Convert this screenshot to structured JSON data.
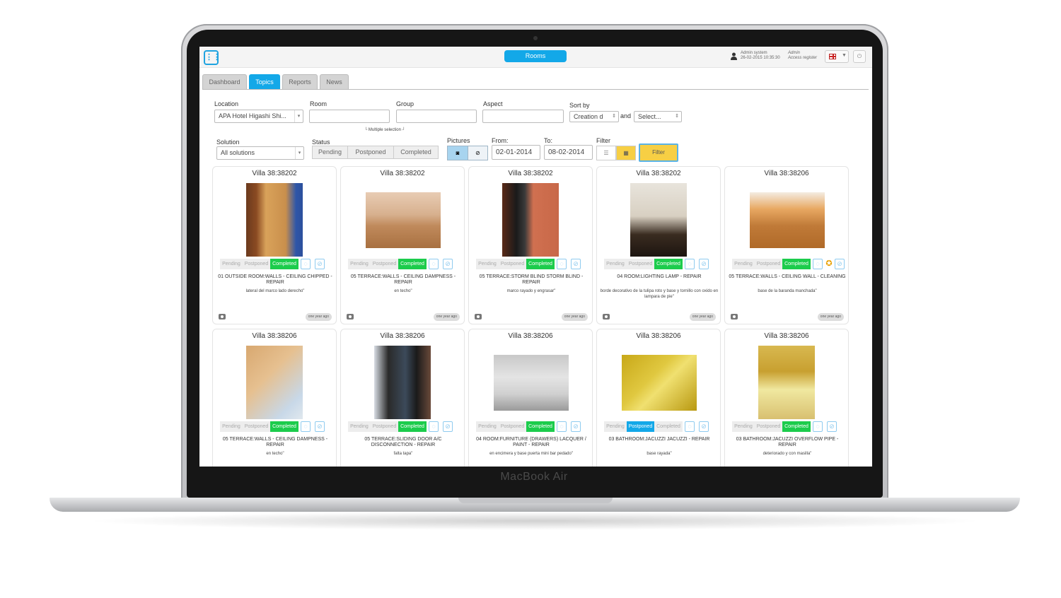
{
  "device": {
    "brand": "MacBook Air"
  },
  "topbar": {
    "rooms_label": "Rooms",
    "user_line1": "Admin system",
    "user_line2": "26-02-2015 10:35:30",
    "admin_line1": "Admin",
    "admin_line2": "Access register"
  },
  "tabs": [
    {
      "label": "Dashboard"
    },
    {
      "label": "Topics",
      "active": true
    },
    {
      "label": "Reports"
    },
    {
      "label": "News"
    }
  ],
  "filters": {
    "location_label": "Location",
    "location_value": "APA Hotel Higashi Shi...",
    "room_label": "Room",
    "group_label": "Group",
    "aspect_label": "Aspect",
    "multiple_selection_hint": "Multiple selection",
    "sort_label": "Sort by",
    "sort_value": "Creation d",
    "and_label": "and",
    "sort2_value": "Select...",
    "solution_label": "Solution",
    "solution_value": "All solutions",
    "status_label": "Status",
    "status_options": [
      "Pending",
      "Postponed",
      "Completed"
    ],
    "pictures_label": "Pictures",
    "from_label": "From:",
    "from_value": "02-01-2014",
    "to_label": "To:",
    "to_value": "08-02-2014",
    "filter_label": "Filter",
    "filter_button": "Filter"
  },
  "status_labels": {
    "pending": "Pending",
    "postponed": "Postponed",
    "completed": "Completed"
  },
  "cards": [
    {
      "title": "Villa 38:38202",
      "aspect": "01 OUTSIDE ROOM:WALLS - CEILING CHIPPED - REPAIR",
      "desc": "lateral del marco lado derecho\"",
      "status": "completed",
      "ago": "one year ago",
      "award": false
    },
    {
      "title": "Villa 38:38202",
      "aspect": "05 TERRACE:WALLS - CEILING DAMPNESS - REPAIR",
      "desc": "en techo\"",
      "status": "completed",
      "ago": "one year ago",
      "award": false
    },
    {
      "title": "Villa 38:38202",
      "aspect": "05 TERRACE:STORM BLIND STORM BLIND - REPAIR",
      "desc": "marco rayado y engrasar\"",
      "status": "completed",
      "ago": "one year ago",
      "award": false
    },
    {
      "title": "Villa 38:38202",
      "aspect": "04 ROOM:LIGHTING LAMP - REPAIR",
      "desc": "borde decorativo de la tulipa roto y base y tornillo con oxido en lampara de pie\"",
      "status": "completed",
      "ago": "one year ago",
      "award": false
    },
    {
      "title": "Villa 38:38206",
      "aspect": "05 TERRACE:WALLS - CEILING WALL - CLEANING",
      "desc": "base de la baranda manchada\"",
      "status": "completed",
      "ago": "one year ago",
      "award": true
    },
    {
      "title": "Villa 38:38206",
      "aspect": "05 TERRACE:WALLS - CEILING DAMPNESS - REPAIR",
      "desc": "en techo\"",
      "status": "completed",
      "ago": "",
      "award": false
    },
    {
      "title": "Villa 38:38206",
      "aspect": "05 TERRACE:SLIDING DOOR A/C DISCONNECTION - REPAIR",
      "desc": "falta tapa\"",
      "status": "completed",
      "ago": "",
      "award": false
    },
    {
      "title": "Villa 38:38206",
      "aspect": "04 ROOM:FURNITURE (DRAWERS) LACQUER / PAINT - REPAIR",
      "desc": "en encimera y base puerta mini bar pedado\"",
      "status": "completed",
      "ago": "",
      "award": false
    },
    {
      "title": "Villa 38:38206",
      "aspect": "03 BATHROOM:JACUZZI JACUZZI - REPAIR",
      "desc": "base rayada\"",
      "status": "postponed",
      "ago": "",
      "award": false
    },
    {
      "title": "Villa 38:38206",
      "aspect": "03 BATHROOM:JACUZZI OVERFLOW PIPE - REPAIR",
      "desc": "deteriorado y con masilla\"",
      "status": "completed",
      "ago": "",
      "award": false
    }
  ],
  "colors": {
    "accent": "#13a8e8",
    "completed": "#1ccc4c",
    "filter": "#f7cf44"
  }
}
